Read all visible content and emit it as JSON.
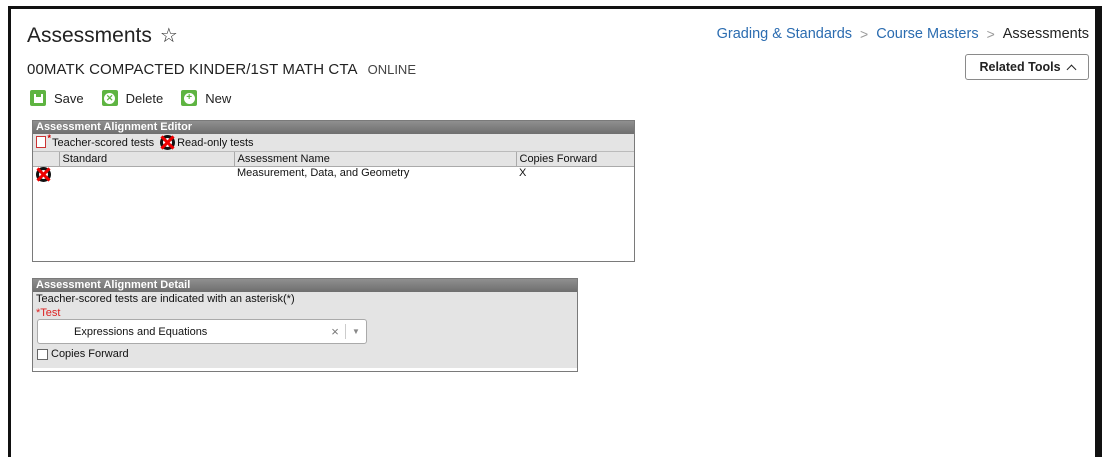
{
  "header": {
    "title": "Assessments",
    "subtitle_name": "00MATK COMPACTED KINDER/1ST MATH CTA",
    "subtitle_mode": "ONLINE"
  },
  "breadcrumb": {
    "items": [
      "Grading & Standards",
      "Course Masters",
      "Assessments"
    ]
  },
  "related_tools": {
    "label": "Related Tools"
  },
  "toolbar": {
    "save_label": "Save",
    "delete_label": "Delete",
    "new_label": "New",
    "accent_color": "#5eb441"
  },
  "editor": {
    "title": "Assessment Alignment Editor",
    "legend_teacher_scored": "Teacher-scored tests",
    "legend_read_only": "Read-only tests",
    "columns": [
      "Standard",
      "Assessment Name",
      "Copies Forward"
    ],
    "rows": [
      {
        "icon": "read-only-icon",
        "standard": "",
        "assessment_name": "Measurement, Data, and Geometry",
        "copies_forward": "X"
      }
    ]
  },
  "detail": {
    "title": "Assessment Alignment Detail",
    "note": "Teacher-scored tests are indicated with an asterisk(*)",
    "test_label": "*Test",
    "test_value": "Expressions and Equations",
    "copies_forward_label": "Copies Forward",
    "copies_forward_checked": false
  },
  "icons": {
    "title_star": "star-outline-icon",
    "chevron": "chevron-up-icon",
    "clear": "clear-x-icon",
    "caret": "caret-down-icon"
  }
}
